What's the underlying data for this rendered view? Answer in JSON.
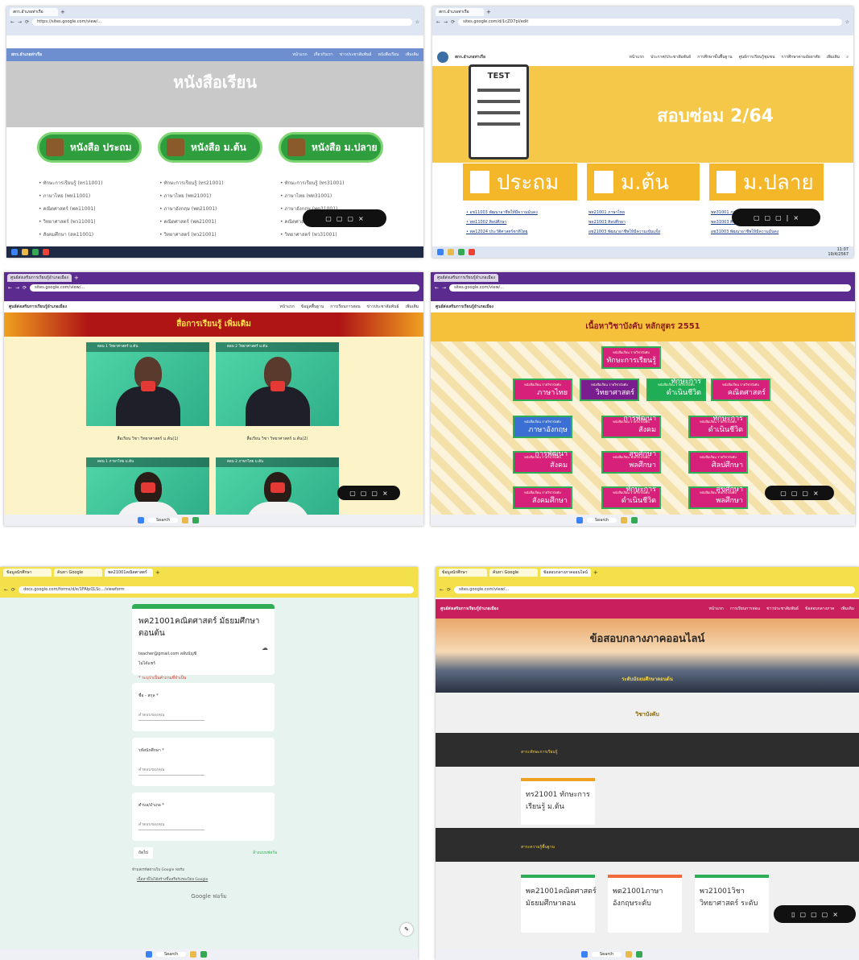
{
  "colors": {
    "p1_nav": "#6d8fcf",
    "p1_banner": "#c9c9c9",
    "p1_btn": "#2f9e3f",
    "p2_yellow": "#f5b72a",
    "p3_purple": "#5b2b8f",
    "p3_banner": "#b01515",
    "p4_gold": "#f5c13b",
    "p4_subject": "#d6207a",
    "p5_header": "#f3e04a",
    "p5_bg": "#e7f3ee",
    "p6_header": "#c91f5c",
    "p6_dark": "#2d2d2d"
  },
  "p1": {
    "tab": "สกร.อำเภอท่าเรือ",
    "url": "https://sites.google.com/view/...",
    "nav_brand": "สกร.อำเภอท่าเรือ",
    "nav_items": [
      "หน้าแรก",
      "เกี่ยวกับเรา",
      "ข่าวประชาสัมพันธ์",
      "หนังสือเรียน",
      "เพิ่มเติม"
    ],
    "banner": "หนังสือเรียน",
    "buttons": [
      "หนังสือ ประถม",
      "หนังสือ ม.ต้น",
      "หนังสือ ม.ปลาย"
    ],
    "list1": [
      "ทักษะการเรียนรู้ (ทร11001)",
      "ภาษาไทย (พท11001)",
      "คณิตศาสตร์ (พค11001)",
      "วิทยาศาสตร์ (พว11001)",
      "สังคมศึกษา (สค11001)"
    ],
    "list2": [
      "ทักษะการเรียนรู้ (ทร21001)",
      "ภาษาไทย (พท21001)",
      "ภาษาอังกฤษ (พต21001)",
      "คณิตศาสตร์ (พค21001)",
      "วิทยาศาสตร์ (พว21001)"
    ],
    "list3": [
      "ทักษะการเรียนรู้ (ทร31001)",
      "ภาษาไทย (พท31001)",
      "ภาษาอังกฤษ (พต31001)",
      "คณิตศาสตร์ (พค31001)",
      "วิทยาศาสตร์ (พว31001)"
    ]
  },
  "p2": {
    "tab": "สกร.อำเภอท่าเรือ",
    "url": "sites.google.com/d/1cZD7pl/edit",
    "nav_brand": "สกร.อำเภอท่าเรือ",
    "nav_items": [
      "หน้าแรก",
      "ประกาศ/ประชาสัมพันธ์",
      "การศึกษาขั้นพื้นฐาน",
      "ศูนย์การเรียนรู้ชุมชน",
      "การศึกษาตามอัธยาศัย",
      "เพิ่มเติม"
    ],
    "test": "TEST",
    "hero": "สอบซ่อม 2/64",
    "levels": [
      "ประถม",
      "ม.ต้น",
      "ม.ปลาย"
    ],
    "col1": [
      "อช11003 พัฒนาอาชีพให้มีความมั่นคง",
      "พท11002 ศิลปศึกษา",
      "พค12024 ประวัติศาสตร์ชาติไทย"
    ],
    "col2": [
      "พท21001 ภาษาไทย",
      "พค21003 ศิลปศึกษา",
      "อช21003 พัฒนาอาชีพให้มีความเข้มแข็ง"
    ],
    "col3": [
      "พท31001 ภาษาไทย",
      "พค31003 ศิลปศึกษา",
      "อช31003 พัฒนาอาชีพให้มีความมั่นคง"
    ],
    "clock": "11:07\n19/4/2567"
  },
  "p3": {
    "tab": "ศูนย์ส่งเสริมการเรียนรู้อำเภอเมือง",
    "url": "sites.google.com/view/...",
    "nav_brand": "ศูนย์ส่งเสริมการเรียนรู้อำเภอเมือง",
    "nav_items": [
      "หน้าแรก",
      "ข้อมูลพื้นฐาน",
      "การเรียนการสอน",
      "ข่าวประชาสัมพันธ์",
      "เพิ่มเติม"
    ],
    "banner": "สื่อการเรียนรู้ เพิ่มเติม",
    "videos": [
      {
        "title": "ตอน 1 วิทยาศาสตร์ ม.ต้น",
        "caption": "สื่อเรียน วิชา วิทยาศาสตร์ ม.ต้น(1)"
      },
      {
        "title": "ตอน 2 วิทยาศาสตร์ ม.ต้น",
        "caption": "สื่อเรียน วิชา วิทยาศาสตร์ ม.ต้น(2)"
      },
      {
        "title": "ตอน 1 ภาษาไทย ม.ต้น",
        "caption": ""
      },
      {
        "title": "ตอน 2 ภาษาไทย ม.ต้น",
        "caption": ""
      }
    ],
    "search": "Search"
  },
  "p4": {
    "tab": "ศูนย์ส่งเสริมการเรียนรู้อำเภอเมือง",
    "url": "sites.google.com/view/...",
    "nav_brand": "ศูนย์ส่งเสริมการเรียนรู้อำเภอเมือง",
    "banner": "เนื้อหาวิชาบังคับ หลักสูตร 2551",
    "subjects": [
      "ทักษะการเรียนรู้",
      "ภาษาไทย",
      "วิทยาศาสตร์",
      "คณิตศาสตร์",
      "ภาษาอังกฤษ",
      "ศิลปศึกษา",
      "สังคมศึกษา",
      "การพัฒนาสังคม",
      "ทักษะการดำเนินชีวิต",
      "สุขศึกษา พลศึกษา"
    ],
    "subject_tag": "หนังสือเรียน รายวิชาบังคับ",
    "search": "Search"
  },
  "p5": {
    "tabs": [
      "ข้อมูลนักศึกษา",
      "ค้นหา Google",
      "พค21001คณิตศาสตร์"
    ],
    "url": "docs.google.com/forms/d/e/1FAIpQLSc.../viewform",
    "form_title": "พค21001คณิตศาสตร์ มัธยมศึกษาตอนต้น",
    "account": "teacher@gmail.com สลับบัญชี",
    "shared": "ไม่ได้แชร์",
    "required_note": "* ระบุว่าเป็นคำถามที่จำเป็น",
    "q1": "ชื่อ - สกุล *",
    "q2": "รหัสนักศึกษา *",
    "q3": "ตำบล/อำเภอ *",
    "answer": "คำตอบของคุณ",
    "next": "ถัดไป",
    "clear": "ล้างแบบฟอร์ม",
    "never": "ห้ามส่งรหัสผ่านใน Google ฟอร์ม",
    "disclaimer": "เนื้อหานี้ไม่ได้สร้างขึ้นหรือรับรองโดย Google",
    "brand": "Google ฟอร์ม",
    "search": "Search"
  },
  "p6": {
    "tabs": [
      "ข้อมูลนักศึกษา",
      "ค้นหา Google",
      "ข้อสอบกลางภาคออนไลน์"
    ],
    "url": "sites.google.com/view/...",
    "nav_brand": "ศูนย์ส่งเสริมการเรียนรู้อำเภอเมือง",
    "nav_items": [
      "หน้าแรก",
      "การเรียนการสอน",
      "ข่าวประชาสัมพันธ์",
      "ข้อสอบกลางภาค",
      "เพิ่มเติม"
    ],
    "hero": "ข้อสอบกลางภาคออนไลน์",
    "sub": "ระดับมัธยมศึกษาตอนต้น",
    "required": "วิชาบังคับ",
    "group1": "สาระทักษะการเรียนรู้",
    "group2": "สาระความรู้พื้นฐาน",
    "cards1": [
      "ทร21001 ทักษะการเรียนรู้ ม.ต้น"
    ],
    "cards2": [
      "พค21001คณิตศาสตร์ มัธยมศึกษาตอน",
      "พต21001ภาษาอังกฤษระดับ",
      "พว21001วิชาวิทยาศาสตร์ ระดับ"
    ],
    "search": "Search"
  }
}
